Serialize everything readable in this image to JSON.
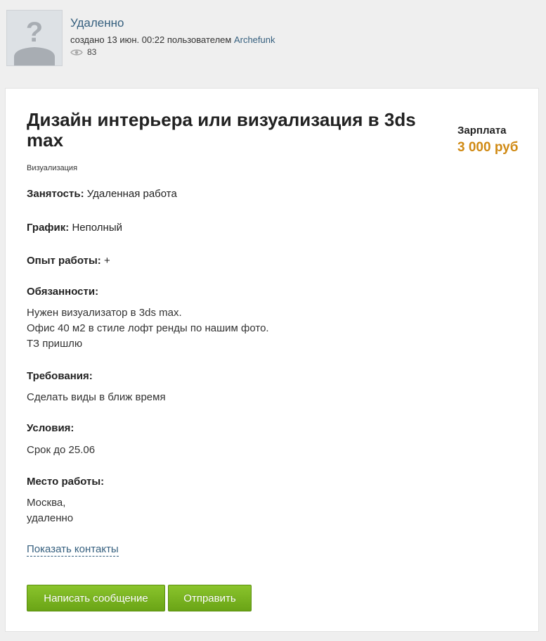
{
  "header": {
    "title": "Удаленно",
    "created_prefix": "создано 13 июн. 00:22 пользователем",
    "author": "Archefunk",
    "views": "83"
  },
  "job": {
    "title": "Дизайн интерьера или визуализация в 3ds max",
    "category": "Визуализация",
    "salary_label": "Зарплата",
    "salary_value": "3 000 руб"
  },
  "fields": {
    "employment_label": "Занятость:",
    "employment_value": "Удаленная работа",
    "schedule_label": "График:",
    "schedule_value": "Неполный",
    "experience_label": "Опыт работы:",
    "experience_value": "+"
  },
  "sections": {
    "duties_label": "Обязанности:",
    "duties_lines": [
      "Нужен визуализатор в 3ds max.",
      "Офис 40 м2 в стиле лофт ренды по нашим фото.",
      "ТЗ пришлю"
    ],
    "requirements_label": "Требования:",
    "requirements_text": "Сделать виды в ближ время",
    "conditions_label": "Условия:",
    "conditions_text": "Срок до 25.06",
    "location_label": "Место работы:",
    "location_lines": [
      "Москва,",
      "удаленно"
    ]
  },
  "actions": {
    "show_contacts": "Показать контакты",
    "write_message": "Написать сообщение",
    "send": "Отправить"
  },
  "colors": {
    "link": "#355f7e",
    "salary": "#d08a14",
    "button": "#7ab621",
    "background": "#efefef"
  },
  "icons": {
    "avatar": "unknown-user-avatar-icon",
    "views": "eye-icon"
  }
}
